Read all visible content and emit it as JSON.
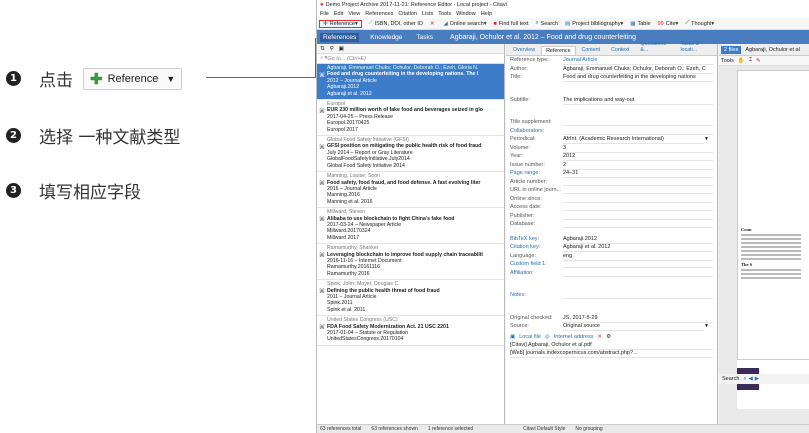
{
  "steps": [
    {
      "num": "1",
      "text": "点击",
      "button": {
        "label": "Reference",
        "caret": "▼"
      }
    },
    {
      "num": "2",
      "text": "选择 一种文献类型"
    },
    {
      "num": "3",
      "text": "填写相应字段"
    }
  ],
  "app": {
    "title": "Demo Project Archive 2017-11-21: Reference Editor - Local project - Citavi",
    "menu": [
      "File",
      "Edit",
      "View",
      "References",
      "Citation",
      "Lists",
      "Tools",
      "Window",
      "Help"
    ],
    "toolbar": [
      "Reference",
      "ISBN, DOI, other ID",
      "Online search",
      "Find full text",
      "Search",
      "Project bibliography",
      "Table",
      "Cite",
      "Thought"
    ],
    "header": {
      "tabs": [
        "References",
        "Knowledge",
        "Tasks"
      ],
      "ref_title": "Agbaraji, Ochulor et al. 2012 – Food and drug counterfeiting"
    },
    "search_placeholder": "Go to... (Ctrl+E)",
    "references": [
      {
        "group": "Agbaraji, Emmanuel Chuks; Ochulor, Deborah O.; Ezeh, Gloria N.",
        "title": "Food and drug counterfeiting in the developing nations. The i",
        "type": "2012 – Journal Article",
        "key1": "Agbaraji.2012",
        "key2": "Agbaraji et al. 2012",
        "selected": true
      },
      {
        "group": "Europol",
        "title": "EUR 230 million worth of fake food and beverages seized in glo",
        "type": "2017-04-25 – Press Release",
        "key1": "Europol.20170425",
        "key2": "Europol 2017"
      },
      {
        "group": "Global Food Safety Initiative (GFSI)",
        "title": "GFSI position on mitigating the public health risk of food fraud",
        "type": "July 2014 – Report or Gray Literature",
        "key1": "GlobalFoodSafetyInitiative.July2014",
        "key2": "Global Food Safety Initiative 2014"
      },
      {
        "group": "Manning, Louise; Soon",
        "title": "Food safety, food fraud, and food defense. A fast evolving liter",
        "type": "2016 – Journal Article",
        "key1": "Manning.2016",
        "key2": "Manning et al. 2016"
      },
      {
        "group": "Millward, Steven",
        "title": "Alibaba to use blockchain to fight China's fake food",
        "type": "2017-03-24 – Newspaper Article",
        "key1": "Millward.20170324",
        "key2": "Millward 2017"
      },
      {
        "group": "Ramamurthy, Shanker",
        "title": "Leveraging blockchain to improve food supply chain traceabilit",
        "type": "2016-11-16 – Internet Document",
        "key1": "Ramamurthy.20161116",
        "key2": "Ramamurthy 2016"
      },
      {
        "group": "Spink, John; Moyer, Douglas C.",
        "title": "Defining the public health threat of food fraud",
        "type": "2011 – Journal Article",
        "key1": "Spink.2011",
        "key2": "Spink et al. 2011"
      },
      {
        "group": "United States Congress (USC)",
        "title": "FDA Food Safety Modernization Act. 21 USC 2201",
        "type": "2017-01-04 – Statute or Regulation",
        "key1": "UnitedStatesCongress.20170104",
        "key2": ""
      }
    ],
    "tabs": [
      "Overview",
      "Reference",
      "Content",
      "Context",
      "Quotations &...",
      "Tasks & locati..."
    ],
    "fields": [
      {
        "label": "Reference type:",
        "value": "Journal Article",
        "blue_val": true
      },
      {
        "label": "Author:",
        "value": "Agbaraji, Emmanuel Chuks; Ochulor, Deborah O.; Ezeh, C"
      },
      {
        "label": "Title:",
        "value": "Food and drug counterfeiting in the developing nations"
      },
      {
        "label": "",
        "value": "",
        "gap": true
      },
      {
        "label": "Subtitle:",
        "value": "The implications and way-out"
      },
      {
        "label": "",
        "value": "",
        "gap": true
      },
      {
        "label": "Title supplement:",
        "value": ""
      },
      {
        "label": "Collaborators:",
        "value": "",
        "blue": true
      },
      {
        "label": "Periodical:",
        "value": "AfrInt. (Academic Research International)"
      },
      {
        "label": "Volume:",
        "value": "3"
      },
      {
        "label": "Year:",
        "value": "2012"
      },
      {
        "label": "Issue number:",
        "value": "2"
      },
      {
        "label": "Page range:",
        "value": "24–31",
        "blue": true
      },
      {
        "label": "Article number:",
        "value": ""
      },
      {
        "label": "URL in online journ...",
        "value": ""
      },
      {
        "label": "Online since:",
        "value": ""
      },
      {
        "label": "Access date:",
        "value": ""
      },
      {
        "label": "Publisher:",
        "value": ""
      },
      {
        "label": "Database:",
        "value": ""
      },
      {
        "label": "",
        "value": "",
        "gap": true
      },
      {
        "label": "BibTeX key:",
        "value": "Agbaraji.2012",
        "blue": true
      },
      {
        "label": "Citation key:",
        "value": "Agbaraji et al. 2012",
        "blue": true
      },
      {
        "label": "Language:",
        "value": "eng"
      },
      {
        "label": "Custom field 1:",
        "value": "",
        "blue": true
      },
      {
        "label": "Affiliation:",
        "value": "",
        "blue": true
      },
      {
        "label": "",
        "value": "",
        "gap2": true
      },
      {
        "label": "Notes:",
        "value": "",
        "blue": true
      },
      {
        "label": "",
        "value": "",
        "gap2": true
      },
      {
        "label": "Original checked:",
        "value": "JS, 2017-5-29"
      },
      {
        "label": "Source:",
        "value": "Original source"
      }
    ],
    "attachments": {
      "local": "Local file",
      "internet": "Internet address",
      "file1": "[Citavi]  Agbaraji, Ochulor et al.pdf",
      "file2": "[Web]  journals.indexcopernicus.com/abstract.php?..."
    },
    "right": {
      "files_tab": "2 files",
      "file_name": "Agbaraji, Ochulor et al",
      "tools": "Tools",
      "search": "Search",
      "page_h1": "Coun",
      "page_h2": "The S"
    },
    "status": [
      "63 references total",
      "63 references shown",
      "1 reference selected",
      "Citavi Default Style",
      "No grouping"
    ]
  }
}
